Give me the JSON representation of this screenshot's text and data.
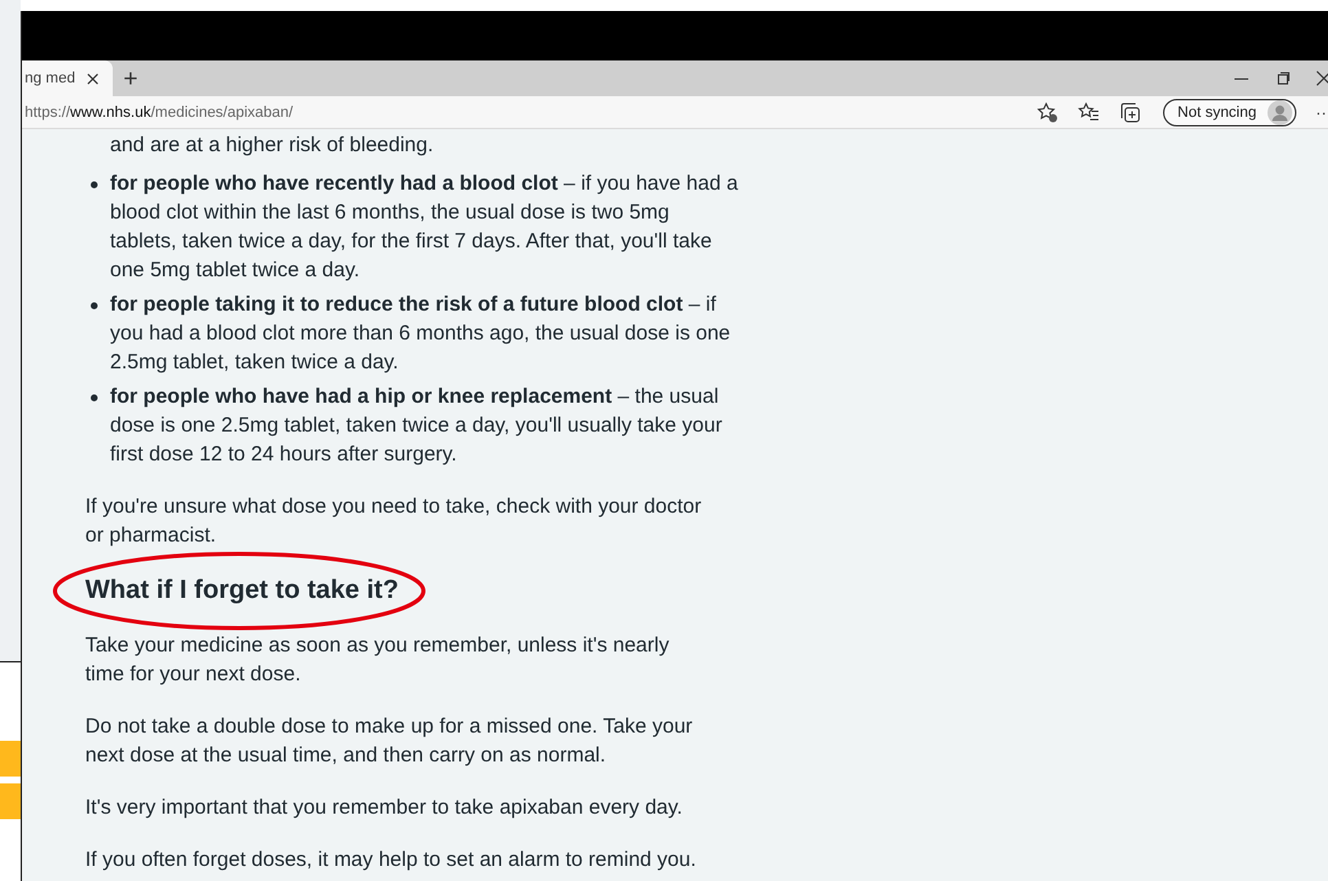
{
  "browser": {
    "tabs": [
      {
        "title": "ng med",
        "selected": true
      }
    ],
    "new_tab": "+",
    "address": {
      "scheme": "https://",
      "host": "www.nhs.uk",
      "path": "/medicines/apixaban/"
    },
    "sync_button": "Not syncing",
    "more": "···"
  },
  "content": [
    {
      "kind": "list",
      "items": [
        {
          "kind": "continuation",
          "text": "and are at a higher risk of bleeding."
        },
        {
          "kind": "bullet",
          "text": "**for people who have recently had a blood clot** – if you have had a blood clot within the last 6 months, the usual dose is two 5mg tablets, taken twice a day, for the first 7 days. After that, you'll take one 5mg tablet twice a day."
        },
        {
          "kind": "bullet",
          "text": "**for people taking it to reduce the risk of a future blood clot** – if you had a blood clot more than 6 months ago, the usual dose is one 2.5mg tablet, taken twice a day."
        },
        {
          "kind": "bullet",
          "text": "**for people who have had a hip or knee replacement** – the usual dose is one 2.5mg tablet, taken twice a day, you'll usually take your first dose 12 to 24 hours after surgery."
        }
      ]
    },
    {
      "kind": "paragraph",
      "text": "If you're unsure what dose you need to take, check with your doctor or pharmacist."
    },
    {
      "kind": "heading",
      "text": "What if I forget to take it?",
      "circled": true
    },
    {
      "kind": "paragraph",
      "text": "Take your medicine as soon as you remember, unless it's nearly time for your next dose."
    },
    {
      "kind": "paragraph",
      "text": "Do not take a double dose to make up for a missed one. Take your next dose at the usual time, and then carry on as normal."
    },
    {
      "kind": "paragraph",
      "text": "It's very important that you remember to take apixaban every day."
    },
    {
      "kind": "paragraph",
      "text": "If you often forget doses, it may help to set an alarm to remind you."
    }
  ]
}
